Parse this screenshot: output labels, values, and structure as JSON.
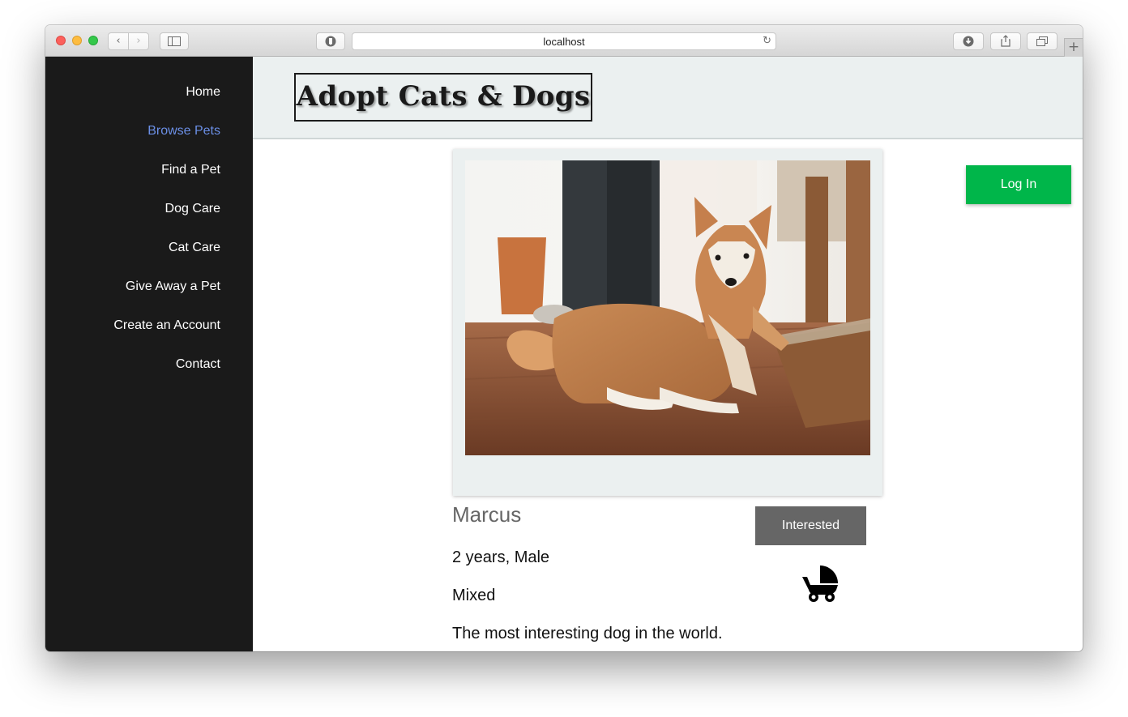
{
  "browser": {
    "url": "localhost",
    "icons": {
      "back": "chevron-left-icon",
      "forward": "chevron-right-icon",
      "sidebar": "sidebar-icon",
      "shield": "shield-icon",
      "reload": "reload-icon",
      "download": "download-icon",
      "share": "share-icon",
      "tabs": "tabs-icon",
      "new_tab": "plus-icon"
    }
  },
  "sidebar": {
    "items": [
      {
        "label": "Home",
        "active": false
      },
      {
        "label": "Browse Pets",
        "active": true
      },
      {
        "label": "Find a Pet",
        "active": false
      },
      {
        "label": "Dog Care",
        "active": false
      },
      {
        "label": "Cat Care",
        "active": false
      },
      {
        "label": "Give Away a Pet",
        "active": false
      },
      {
        "label": "Create an Account",
        "active": false
      },
      {
        "label": "Contact",
        "active": false
      }
    ],
    "active_color": "#6b8fe6"
  },
  "header": {
    "logo_text": "Adopt Cats & Dogs"
  },
  "auth": {
    "login_label": "Log In",
    "login_color": "#00b64a"
  },
  "pet": {
    "name": "Marcus",
    "age_sex": "2 years, Male",
    "breed": "Mixed",
    "description": "The most interesting dog in the world.",
    "interested_label": "Interested",
    "photo_subject": "shiba-inu-dog-photo",
    "badge_icon": "baby-stroller-icon"
  }
}
